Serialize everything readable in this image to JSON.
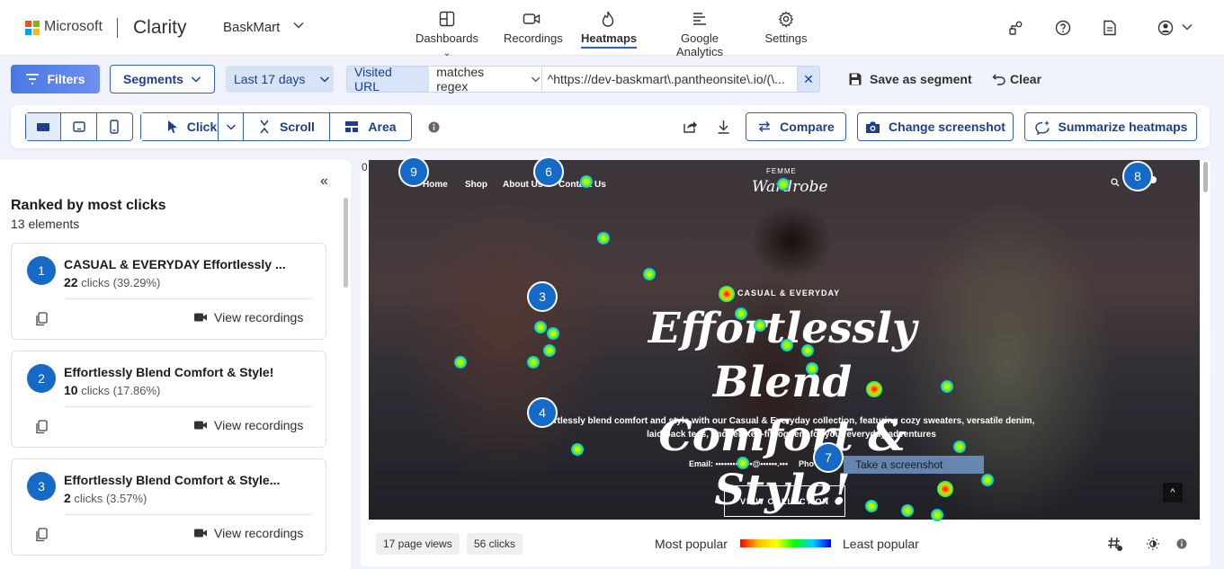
{
  "colors": {
    "accent": "#2f5fc7",
    "badge": "#1569c7",
    "filters_bg": "#5b82ea"
  },
  "header": {
    "company": "Microsoft",
    "product": "Clarity",
    "project": "BaskMart",
    "nav": [
      {
        "label": "Dashboards",
        "icon": "dashboard-icon"
      },
      {
        "label": "Recordings",
        "icon": "video-icon"
      },
      {
        "label": "Heatmaps",
        "icon": "flame-icon",
        "active": true
      },
      {
        "label": "Google Analytics",
        "icon": "analytics-icon"
      },
      {
        "label": "Settings",
        "icon": "gear-icon"
      }
    ]
  },
  "filterbar": {
    "filters": "Filters",
    "segments": "Segments",
    "range": "Last 17 days",
    "url_label": "Visited URL",
    "url_operator": "matches regex",
    "url_value": "^https://dev-baskmart\\.pantheonsite\\.io/(\\...",
    "save_segment": "Save as segment",
    "clear": "Clear"
  },
  "toolbar": {
    "modes": [
      "Click",
      "Scroll",
      "Area"
    ],
    "compare": "Compare",
    "change_screenshot": "Change screenshot",
    "summarize": "Summarize heatmaps"
  },
  "sidebar": {
    "title": "Ranked by most clicks",
    "subtitle": "13 elements",
    "items": [
      {
        "rank": "1",
        "title": "CASUAL & EVERYDAY Effortlessly ...",
        "count": "22",
        "unit": "clicks",
        "pct": "(39.29%)",
        "action": "View recordings"
      },
      {
        "rank": "2",
        "title": "Effortlessly Blend Comfort & Style!",
        "count": "10",
        "unit": "clicks",
        "pct": "(17.86%)",
        "action": "View recordings"
      },
      {
        "rank": "3",
        "title": "Effortlessly Blend Comfort & Style...",
        "count": "2",
        "unit": "clicks",
        "pct": "(3.57%)",
        "action": "View recordings"
      }
    ]
  },
  "heatmap": {
    "ruler_zero": "0",
    "site": {
      "nav": [
        "Home",
        "Shop",
        "About Us",
        "Contact Us"
      ],
      "brand_top": "FEMME",
      "brand": "Wardrobe",
      "kicker": "CASUAL & EVERYDAY",
      "headline_1": "Effortlessly Blend",
      "headline_2": "Comfort & Style!",
      "para_1": "ortlessly blend comfort and style with our Casual & Everyday collection, featuring cozy sweaters, versatile denim,",
      "para_2": "laid-back tees, and relaxed-fit joggers for your everyday adventures",
      "email": "Email: •••••••••••••@••••••.•••",
      "phone": "Pho",
      "cta": "VIEW COLLECTION",
      "back_to_top": "^"
    },
    "badges": [
      "9",
      "6",
      "8",
      "3",
      "4",
      "7"
    ],
    "tooltip": "Take a screenshot"
  },
  "footer": {
    "page_views": "17 page views",
    "clicks": "56 clicks",
    "most": "Most popular",
    "least": "Least popular"
  }
}
